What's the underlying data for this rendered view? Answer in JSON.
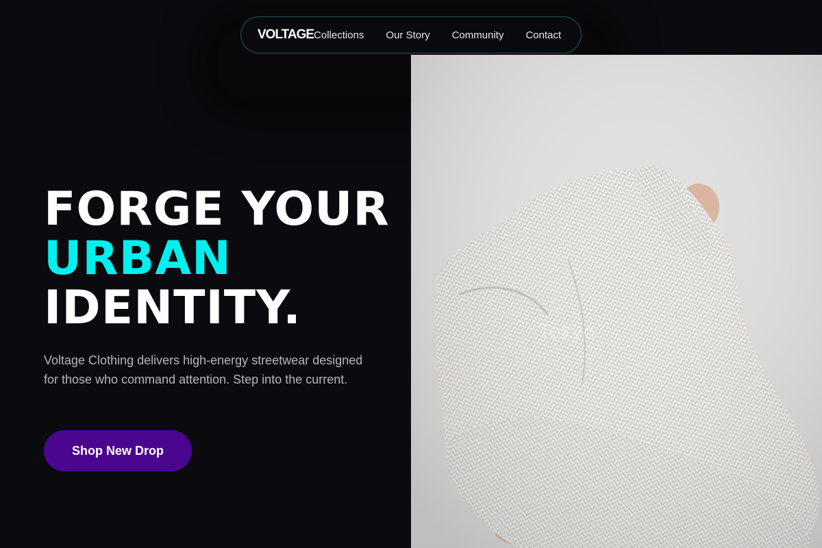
{
  "nav": {
    "logo": "VOLTAGE",
    "links": [
      "Collections",
      "Our Story",
      "Community",
      "Contact"
    ]
  },
  "hero": {
    "title_line1": "FORGE YOUR",
    "title_line2": "URBAN",
    "title_line3": "IDENTITY.",
    "subtitle": "Voltage Clothing delivers high-energy streetwear designed for those who command attention. Step into the current.",
    "cta_label": "Shop New Drop",
    "image_watermark": "Tokyo"
  },
  "colors": {
    "background": "#0b0b0f",
    "accent_cyan": "#00f0f0",
    "cta_purple": "#4b0690",
    "nav_border": "#1a5b5b"
  }
}
